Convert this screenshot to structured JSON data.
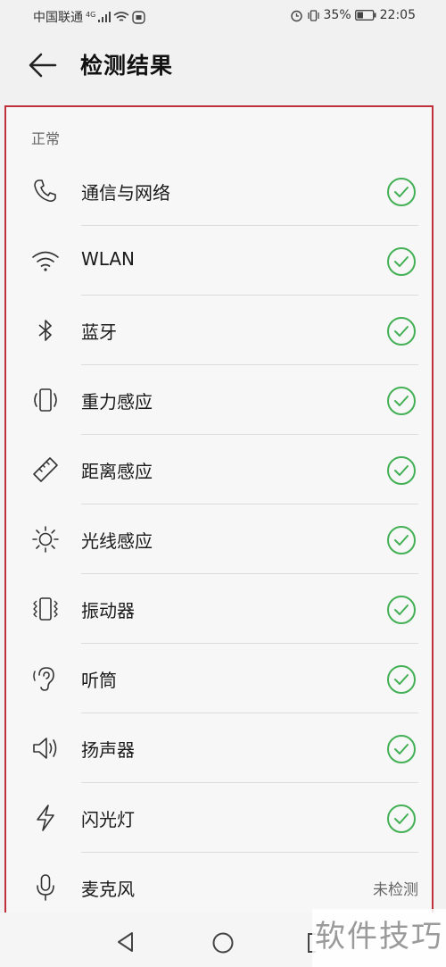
{
  "status_bar": {
    "carrier": "中国联通",
    "network_type": "4G",
    "battery_percent": "35%",
    "time": "22:05"
  },
  "header": {
    "title": "检测结果"
  },
  "section": {
    "label": "正常"
  },
  "items": [
    {
      "label": "通信与网络",
      "icon": "phone-icon",
      "status": "passed"
    },
    {
      "label": "WLAN",
      "icon": "wifi-icon",
      "status": "passed"
    },
    {
      "label": "蓝牙",
      "icon": "bluetooth-icon",
      "status": "passed"
    },
    {
      "label": "重力感应",
      "icon": "gravity-sensor-icon",
      "status": "passed"
    },
    {
      "label": "距离感应",
      "icon": "proximity-sensor-icon",
      "status": "passed"
    },
    {
      "label": "光线感应",
      "icon": "light-sensor-icon",
      "status": "passed"
    },
    {
      "label": "振动器",
      "icon": "vibration-icon",
      "status": "passed"
    },
    {
      "label": "听筒",
      "icon": "earpiece-icon",
      "status": "passed"
    },
    {
      "label": "扬声器",
      "icon": "speaker-icon",
      "status": "passed"
    },
    {
      "label": "闪光灯",
      "icon": "flash-icon",
      "status": "passed"
    },
    {
      "label": "麦克风",
      "icon": "microphone-icon",
      "status": "未检测"
    }
  ],
  "colors": {
    "check_green": "#43b055",
    "highlight_border": "#c0303a"
  },
  "watermark": {
    "text": "软件技巧"
  }
}
